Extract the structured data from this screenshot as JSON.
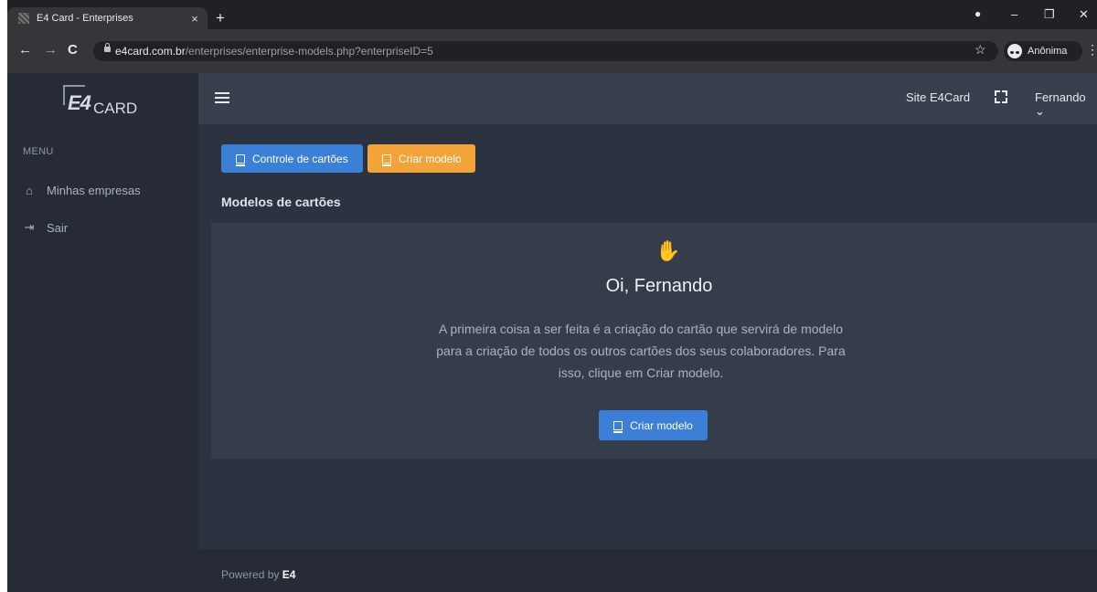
{
  "browser": {
    "tab_title": "E4 Card - Enterprises",
    "tab_close": "×",
    "new_tab": "+",
    "url_host": "e4card.com.br",
    "url_path": "/enterprises/enterprise-models.php?enterpriseID=5",
    "profile_name": "Anônima",
    "controls": {
      "minimize": "–",
      "maximize": "❐",
      "close": "✕"
    },
    "nav": {
      "back": "←",
      "forward": "→",
      "reload": "C",
      "star": "☆",
      "menu": "⋮"
    }
  },
  "logo": {
    "mark": "E4",
    "text": "CARD"
  },
  "sidebar": {
    "menu_label": "MENU",
    "items": [
      {
        "label": "Minhas empresas",
        "icon": "home-icon",
        "glyph": "⌂"
      },
      {
        "label": "Sair",
        "icon": "logout-icon",
        "glyph": "⇥"
      }
    ]
  },
  "topbar": {
    "site_link": "Site E4Card",
    "user": "Fernando ⌄"
  },
  "actions": {
    "controle_label": "Controle de cartões",
    "criar_label": "Criar modelo"
  },
  "section_title": "Modelos de cartões",
  "welcome": {
    "icon": "hand-wave-icon",
    "glyph": "✋",
    "greeting": "Oi, Fernando",
    "description": "A primeira coisa a ser feita é a criação do cartão que servirá de modelo para a criação de todos os outros cartões dos seus colaboradores. Para isso, clique em Criar modelo.",
    "button_label": "Criar modelo"
  },
  "footer": {
    "prefix": "Powered by ",
    "brand": "E4"
  },
  "colors": {
    "primary": "#3c7fd6",
    "warning": "#f2a33a",
    "background": "#2c3340",
    "sidebar": "#262b36"
  }
}
